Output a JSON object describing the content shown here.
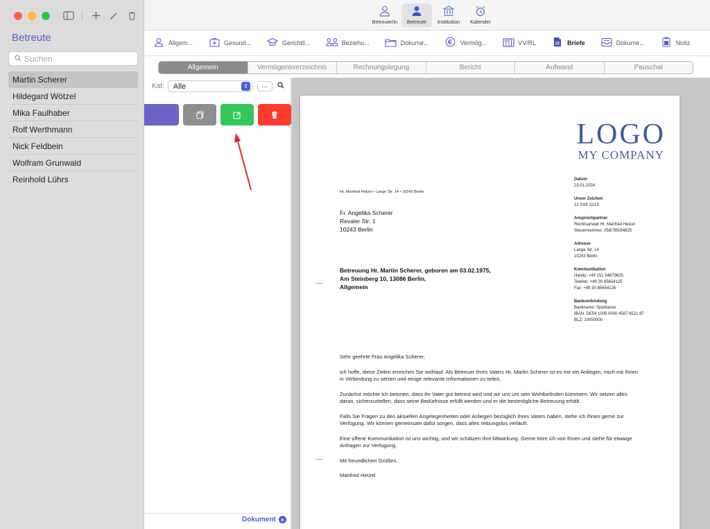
{
  "window": {
    "traffic_lights": [
      "#ff5f57",
      "#febc2e",
      "#28c840"
    ]
  },
  "sidebar": {
    "title": "Betreute",
    "search_placeholder": "Suchen",
    "items": [
      "Martin Scherer",
      "Hildegard Wötzel",
      "Mika Faulhaber",
      "Rolf Werthmann",
      "Nick Feldbein",
      "Wolfram Grunwald",
      "Reinhold Lührs"
    ],
    "selected_index": 0
  },
  "toolbar": {
    "buttons": [
      {
        "label": "Betreuer/in",
        "icon": "person-outline-icon"
      },
      {
        "label": "Betreute",
        "icon": "person-filled-icon",
        "active": true
      },
      {
        "label": "Institution",
        "icon": "institution-icon"
      },
      {
        "label": "Kalender",
        "icon": "alarm-clock-icon"
      }
    ]
  },
  "tabs": [
    {
      "label": "Allgem...",
      "icon": "person-icon"
    },
    {
      "label": "Gesund...",
      "icon": "medical-bag-icon"
    },
    {
      "label": "Gerichtli...",
      "icon": "graduation-cap-icon"
    },
    {
      "label": "Beziehu...",
      "icon": "people-icon"
    },
    {
      "label": "Dokume...",
      "icon": "folder-icon"
    },
    {
      "label": "Vermög...",
      "icon": "euro-icon"
    },
    {
      "label": "VV/RL",
      "icon": "document-columns-icon"
    },
    {
      "label": "Briefe",
      "icon": "letter-icon",
      "active": true
    },
    {
      "label": "Dokume...",
      "icon": "inbox-icon"
    },
    {
      "label": "Notiz",
      "icon": "note-icon"
    }
  ],
  "subtabs": [
    "Allgemein",
    "Vermögensverzeichnis",
    "Rechnungslegung",
    "Bericht",
    "Aufwand",
    "Pauschal"
  ],
  "subtab_active": 0,
  "filter": {
    "label": "Kat:",
    "value": "Alle",
    "more": "···"
  },
  "actions": {
    "colors": [
      "#6c63c7",
      "#8e8e8e",
      "#34c759",
      "#ff3b30"
    ]
  },
  "footer": {
    "add_document": "Dokument"
  },
  "letter": {
    "logo_line1": "LOGO",
    "logo_line2": "MY COMPANY",
    "sender_line": "Hr. Manfred Hetzel • Lange Str. 14 • 10243 Berlin",
    "recipient": [
      "Fr. Angelika Scherer",
      "Revaler Str. 1",
      "10243 Berlin"
    ],
    "meta": {
      "datum_label": "Datum",
      "datum": "23.01.2024",
      "zeichen_label": "Unser Zeichen",
      "zeichen": "12 XXII 11/15",
      "ansprech_label": "Ansprechpartner",
      "ansprech1": "Rechtsanwalt Hr. Manfred Hetzel",
      "ansprech2": "Steuernummer: 058/785/54825",
      "adresse_label": "Adresse",
      "adresse1": "Lange Str. 14",
      "adresse2": "10243 Berlin",
      "komm_label": "Kommunikation",
      "komm1": "Handy: +49 151 54879625",
      "komm2": "Telefon: +49 30 85654125",
      "komm3": "Fax: +49 30 85654126",
      "bank_label": "Bankverbindung",
      "bank1": "Bankname: Sparkasse",
      "bank2": "IBAN: DE54 1005 0000 4587 6521 87",
      "bank3": "BLZ: 10050000"
    },
    "subject": [
      "Betreuung Hr. Martin Scherer, geboren am 03.02.1975,",
      "Am Steinberg 10, 13086 Berlin,",
      "Allgemein"
    ],
    "salutation": "Sehr geehrte Frau Angelika Scherer,",
    "paragraphs": [
      "ich hoffe, diese Zeilen erreichen Sie wohlauf. Als Betreuer Ihres Vaters Hr. Martin Scherer ist es mir ein Anliegen, mich mit Ihnen in Verbindung zu setzen und einige relevante Informationen zu teilen.",
      "Zunächst möchte ich betonen, dass Ihr Vater gut betreut wird und wir uns um sein Wohlbefinden kümmern. Wir setzen alles daran, sicherzustellen, dass seine Bedürfnisse erfüllt werden und er die bestmögliche Betreuung erhält.",
      "Falls Sie Fragen zu den aktuellen Angelegenheiten oder Anliegen bezüglich Ihres Vaters haben, stehe ich Ihnen gerne zur Verfügung. Wir können gemeinsam dafür sorgen, dass alles reibungslos verläuft.",
      "Eine offene Kommunikation ist uns wichtig, und wir schätzen Ihre Mitwirkung. Gerne höre ich von Ihnen und stehe für etwaige Anfragen zur Verfügung."
    ],
    "closing": "Mit freundlichen Grüßen,",
    "signature": "Manfred Hetzel"
  }
}
